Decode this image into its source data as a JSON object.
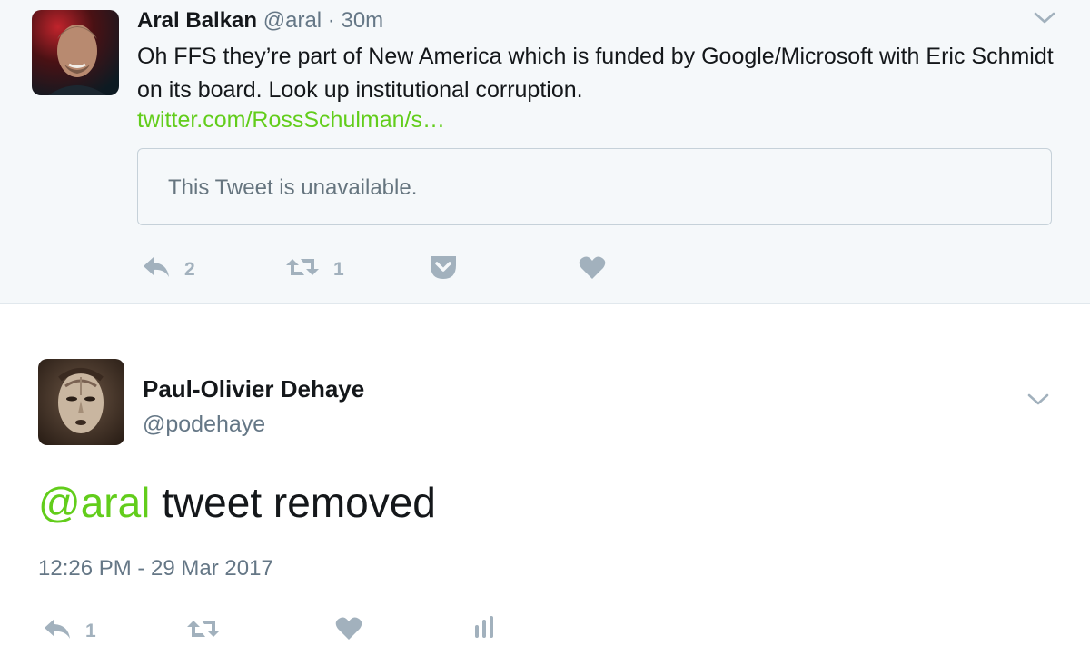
{
  "tweet1": {
    "author_name": "Aral Balkan",
    "author_handle": "@aral",
    "separator": "·",
    "time": "30m",
    "text": "Oh FFS they’re part of New America which is funded by Google/Microsoft with Eric Schmidt on its board. Look up institutional corruption.",
    "link": "twitter.com/RossSchulman/s…",
    "quoted": "This Tweet is unavailable.",
    "actions": {
      "reply_count": "2",
      "retweet_count": "1"
    }
  },
  "tweet2": {
    "author_name": "Paul-Olivier Dehaye",
    "author_handle": "@podehaye",
    "mention": "@aral",
    "text": " tweet removed",
    "timestamp": "12:26 PM - 29 Mar 2017",
    "actions": {
      "reply_count": "1"
    }
  },
  "icons": {
    "reply": "reply-icon",
    "retweet": "retweet-icon",
    "pocket": "pocket-icon",
    "like": "heart-icon",
    "analytics": "analytics-icon",
    "more": "chevron-down-icon"
  },
  "colors": {
    "link": "#62cd1b",
    "muted": "#657786",
    "action": "#a2b1bd",
    "top_background": "#f5f8fa"
  }
}
